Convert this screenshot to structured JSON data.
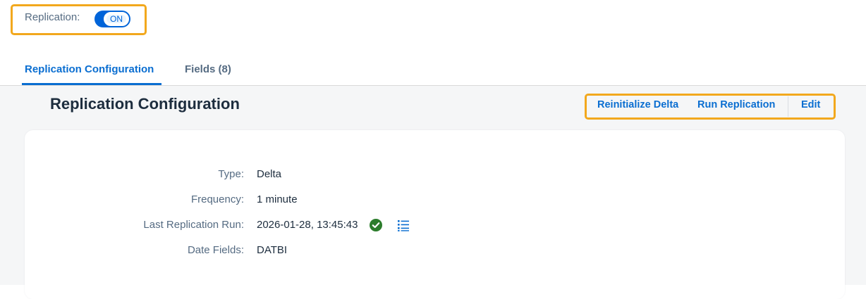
{
  "header": {
    "replication_label": "Replication:",
    "replication_toggle_state": "ON"
  },
  "tabs": [
    {
      "label": "Replication Configuration",
      "selected": true
    },
    {
      "label": "Fields (8)",
      "selected": false
    }
  ],
  "section": {
    "title": "Replication Configuration",
    "actions": {
      "reinitialize_delta": "Reinitialize Delta",
      "run_replication": "Run Replication",
      "edit": "Edit"
    }
  },
  "fields": {
    "type": {
      "label": "Type:",
      "value": "Delta"
    },
    "frequency": {
      "label": "Frequency:",
      "value": "1 minute"
    },
    "last_run": {
      "label": "Last Replication Run:",
      "value": "2026-01-28, 13:45:43",
      "status_icon": "check-circle-icon",
      "details_icon": "list-icon"
    },
    "date_fields": {
      "label": "Date Fields:",
      "value": "DATBI"
    }
  },
  "colors": {
    "accent": "#0a6ed1",
    "highlight": "#f2a81d",
    "success": "#2b7c2b",
    "background": "#f5f6f7"
  }
}
